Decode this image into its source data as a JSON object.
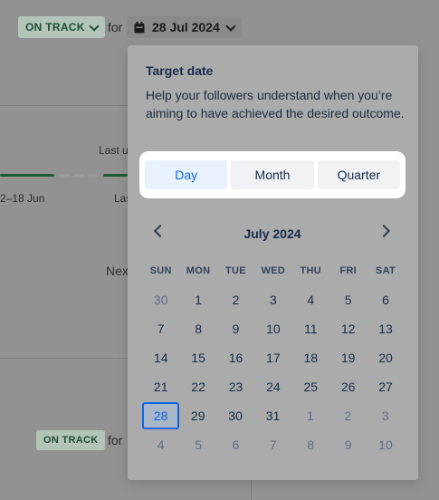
{
  "header": {
    "status_label": "ON TRACK",
    "for_label": "for",
    "date_label": "28 Jul 2024"
  },
  "background": {
    "last_update_partial": "Last u",
    "date_range_partial": "2–18 Jun",
    "last_partial": "Las",
    "next_partial": "Next",
    "status_label_2": "ON TRACK",
    "for_label_2": "for"
  },
  "popup": {
    "title": "Target date",
    "description": "Help your followers understand when you’re aiming to have achieved the desired outcome.",
    "toggle": [
      "Day",
      "Month",
      "Quarter"
    ],
    "active_toggle": "Day"
  },
  "calendar": {
    "month_label": "July 2024",
    "weekdays": [
      "SUN",
      "MON",
      "TUE",
      "WED",
      "THU",
      "FRI",
      "SAT"
    ],
    "weeks": [
      [
        "30",
        "1",
        "2",
        "3",
        "4",
        "5",
        "6"
      ],
      [
        "7",
        "8",
        "9",
        "10",
        "11",
        "12",
        "13"
      ],
      [
        "14",
        "15",
        "16",
        "17",
        "18",
        "19",
        "20"
      ],
      [
        "21",
        "22",
        "23",
        "24",
        "25",
        "26",
        "27"
      ],
      [
        "28",
        "29",
        "30",
        "31",
        "1",
        "2",
        "3"
      ],
      [
        "4",
        "5",
        "6",
        "7",
        "8",
        "9",
        "10"
      ]
    ],
    "selected_day": "28"
  }
}
